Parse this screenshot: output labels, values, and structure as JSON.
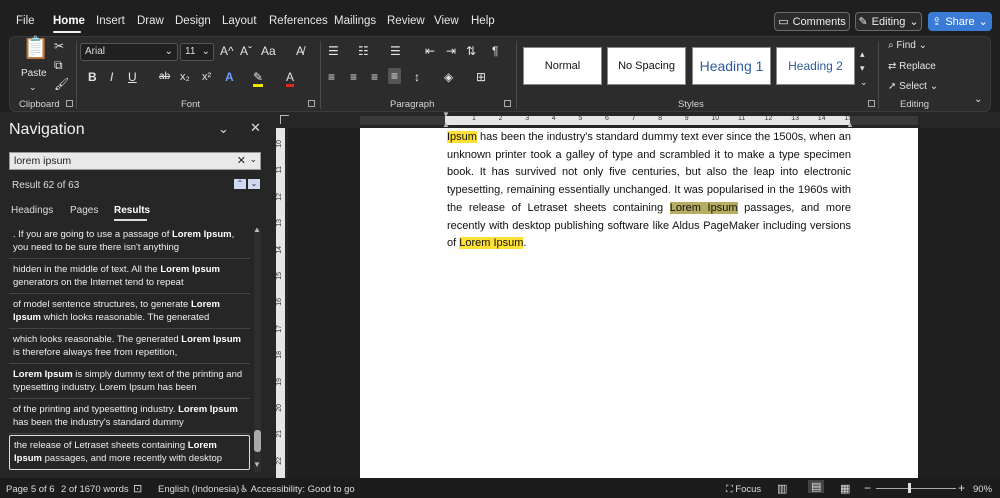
{
  "tabs": [
    "File",
    "Home",
    "Insert",
    "Draw",
    "Design",
    "Layout",
    "References",
    "Mailings",
    "Review",
    "View",
    "Help"
  ],
  "active_tab": "Home",
  "top_buttons": {
    "comments": "Comments",
    "editing": "Editing",
    "share": "Share"
  },
  "ribbon": {
    "clipboard": {
      "paste": "Paste",
      "label": "Clipboard"
    },
    "font": {
      "name": "Arial",
      "size": "11",
      "label": "Font",
      "bold": "B",
      "italic": "I",
      "underline": "U",
      "strike": "ab",
      "sub": "x₂",
      "sup": "x²",
      "grow": "A^",
      "shrink": "Aˇ",
      "case": "Aa"
    },
    "paragraph": {
      "label": "Paragraph"
    },
    "styles": {
      "label": "Styles",
      "items": [
        "Normal",
        "No Spacing",
        "Heading 1",
        "Heading 2"
      ]
    },
    "editing": {
      "label": "Editing",
      "find": "Find",
      "replace": "Replace",
      "select": "Select"
    }
  },
  "navigation": {
    "title": "Navigation",
    "search_value": "lorem ipsum",
    "result_count": "Result 62 of 63",
    "tabs": [
      "Headings",
      "Pages",
      "Results"
    ],
    "results": [
      {
        "pre": ". If you are going to use a passage of ",
        "bold": "Lorem Ipsum",
        ",post": "",
        "post2": ", you need to be sure there isn't anything"
      },
      {
        "pre": "hidden in the middle of text. All the ",
        "bold": "Lorem Ipsum",
        "post2": " generators on the Internet tend to repeat"
      },
      {
        "pre": "of model sentence structures, to generate ",
        "bold": "Lorem Ipsum",
        "post2": " which looks reasonable. The generated"
      },
      {
        "pre": "which looks reasonable. The generated ",
        "bold": "Lorem Ipsum",
        "post2": " is therefore always free from repetition,"
      },
      {
        "pre": "",
        "bold": "Lorem Ipsum",
        "post2": " is simply dummy text of the printing and typesetting industry. Lorem Ipsum has been"
      },
      {
        "pre": "of the printing and typesetting industry. ",
        "bold": "Lorem Ipsum",
        "post2": " has been the industry's standard dummy"
      },
      {
        "pre": "the release of Letraset sheets containing ",
        "bold": "Lorem Ipsum",
        "post2": " passages, and more recently with desktop"
      }
    ]
  },
  "ruler_labels": [
    "1",
    "2",
    "3",
    "4",
    "5",
    "6",
    "7",
    "8",
    "9",
    "10",
    "11",
    "12",
    "13",
    "14",
    "15"
  ],
  "vruler_labels": [
    "10",
    "11",
    "12",
    "13",
    "14",
    "15",
    "16",
    "17",
    "18",
    "19",
    "20",
    "21",
    "22"
  ],
  "document": {
    "s1": "Ipsum",
    "s2": " has been the industry's standard dummy text ever since the 1500s, when an unknown printer took a galley of type and scrambled it to make a type specimen book. It has survived not only five centuries, but also the leap into electronic typesetting, remaining essentially unchanged. It was popularised in the 1960s with the release of Letraset sheets containing ",
    "s3": "Lorem Ipsum",
    "s4": " passages, and more recently with desktop publishing software like Aldus PageMaker including versions of ",
    "s5": "Lorem Ipsum",
    "s6": "."
  },
  "status": {
    "page": "Page 5 of 6",
    "words": "2 of 1670 words",
    "language": "English (Indonesia)",
    "accessibility": "Accessibility: Good to go",
    "focus": "Focus",
    "zoom": "90%"
  }
}
